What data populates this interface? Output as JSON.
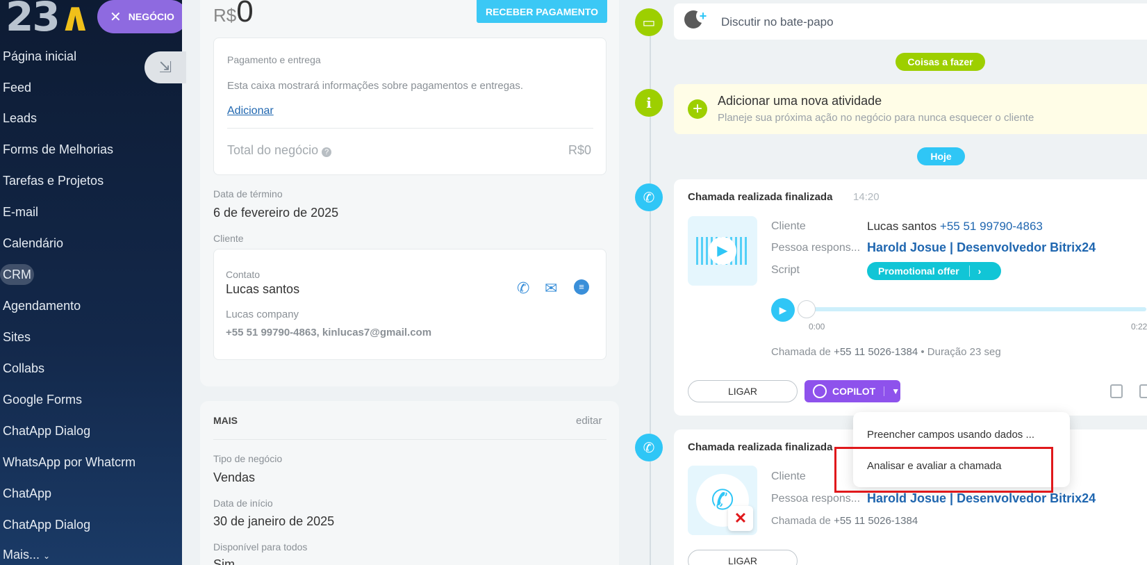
{
  "sidebar": {
    "logo_text": "23",
    "logo_mark": "∧",
    "deal_label": "NEGÓCIO",
    "items": [
      {
        "label": "Página inicial"
      },
      {
        "label": "Feed"
      },
      {
        "label": "Leads"
      },
      {
        "label": "Forms de Melhorias"
      },
      {
        "label": "Tarefas e Projetos"
      },
      {
        "label": "E-mail"
      },
      {
        "label": "Calendário"
      },
      {
        "label": "CRM"
      },
      {
        "label": "Agendamento"
      },
      {
        "label": "Sites"
      },
      {
        "label": "Collabs"
      },
      {
        "label": "Google Forms"
      },
      {
        "label": "ChatApp Dialog"
      },
      {
        "label": "WhatsApp por Whatcrm"
      },
      {
        "label": "ChatApp"
      },
      {
        "label": "ChatApp Dialog"
      },
      {
        "label": "Mais..."
      }
    ]
  },
  "deal": {
    "currency": "R$",
    "amount": "0",
    "receive_payment": "RECEBER PAGAMENTO",
    "payment_title": "Pagamento e entrega",
    "payment_desc": "Esta caixa mostrará informações sobre pagamentos e entregas.",
    "add_link": "Adicionar",
    "total_label": "Total do negócio",
    "total_value": "R$0",
    "end_date_label": "Data de término",
    "end_date_value": "6 de fevereiro de 2025",
    "client_label": "Cliente",
    "contact_label": "Contato",
    "contact_name": "Lucas santos",
    "company": "Lucas company",
    "contact_details": "+55 51 99790-4863, kinlucas7@gmail.com"
  },
  "more": {
    "title": "MAIS",
    "edit": "editar",
    "type_label": "Tipo de negócio",
    "type_value": "Vendas",
    "start_label": "Data de início",
    "start_value": "30 de janeiro de 2025",
    "available_label": "Disponível para todos",
    "available_value": "Sim"
  },
  "timeline": {
    "chat_placeholder": "Discutir no bate-papo",
    "todo_pill": "Coisas a fazer",
    "activity_title": "Adicionar uma nova atividade",
    "activity_desc": "Planeje sua próxima ação no negócio para nunca esquecer o cliente",
    "today_pill": "Hoje",
    "call1": {
      "title": "Chamada realizada finalizada",
      "time": "14:20",
      "client_label": "Cliente",
      "client_name": "Lucas santos",
      "client_phone": "+55 51 99790-4863",
      "responsible_label": "Pessoa respons...",
      "responsible_name": "Harold Josue | Desenvolvedor Bitrix24",
      "script_label": "Script",
      "script_button": "Promotional offer",
      "time_start": "0:00",
      "time_end": "0:22",
      "call_from_label": "Chamada de",
      "call_from_number": "+55 11 5026-1384",
      "duration": "• Duração 23 seg",
      "call_button": "LIGAR",
      "copilot_button": "COPILOT",
      "progress": 0
    },
    "call2": {
      "title": "Chamada realizada finalizada",
      "client_label": "Cliente",
      "responsible_label": "Pessoa respons...",
      "responsible_name": "Harold Josue | Desenvolvedor Bitrix24",
      "call_from_label": "Chamada de",
      "call_from_number": "+55 11 5026-1384",
      "call_button": "LIGAR"
    },
    "copilot_menu": [
      {
        "label": "Preencher campos usando dados ..."
      },
      {
        "label": "Analisar e avaliar a chamada"
      }
    ]
  }
}
